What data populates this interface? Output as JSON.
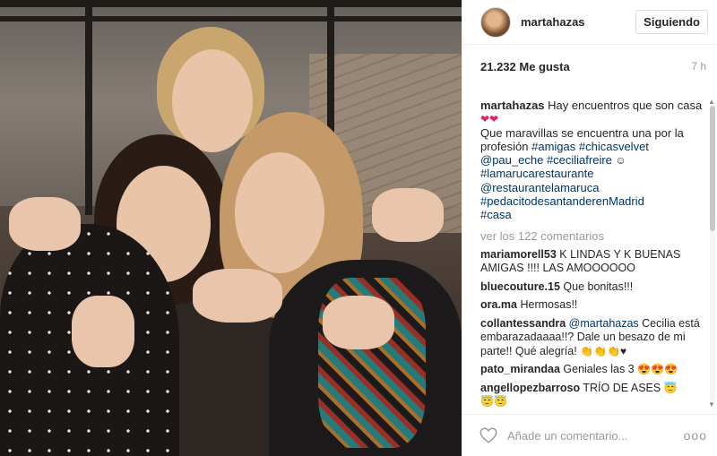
{
  "header": {
    "username": "martahazas",
    "follow_label": "Siguiendo"
  },
  "meta": {
    "likes": "21.232 Me gusta",
    "time": "7 h"
  },
  "caption": {
    "user": "martahazas",
    "line1": "Hay encuentros que son casa",
    "line2": "Que maravillas se encuentra una por la profesión",
    "tags": [
      "#amigas",
      "#chicasvelvet",
      "@pau_eche",
      "#ceciliafreire",
      "#lamarucarestaurante",
      "@restaurantelamaruca",
      "#pedacitodesantanderenMadrid",
      "#casa"
    ]
  },
  "view_comments": "ver los 122 comentarios",
  "comments": [
    {
      "user": "mariamorell53",
      "text": "K LINDAS Y K BUENAS AMIGAS !!!! LAS AMOOOOOO"
    },
    {
      "user": "bluecouture.15",
      "text": "Que bonitas!!!"
    },
    {
      "user": "ora.ma",
      "text": "Hermosas!!"
    },
    {
      "user": "collantessandra",
      "mention": "@martahazas",
      "text": "Cecilia está embarazadaaaa!!? Dale un besazo de mi parte!! Qué alegría!"
    },
    {
      "user": "pato_mirandaa",
      "text": "Geniales las 3"
    },
    {
      "user": "angellopezbarroso",
      "text": "TRÍO DE ASES"
    }
  ],
  "footer": {
    "placeholder": "Añade un comentario...",
    "more": "ooo"
  },
  "colors": {
    "accent": "#003569",
    "muted": "#999999",
    "heart": "#e0245e"
  },
  "icons": [
    "heart-outline-icon",
    "ellipsis-icon"
  ]
}
